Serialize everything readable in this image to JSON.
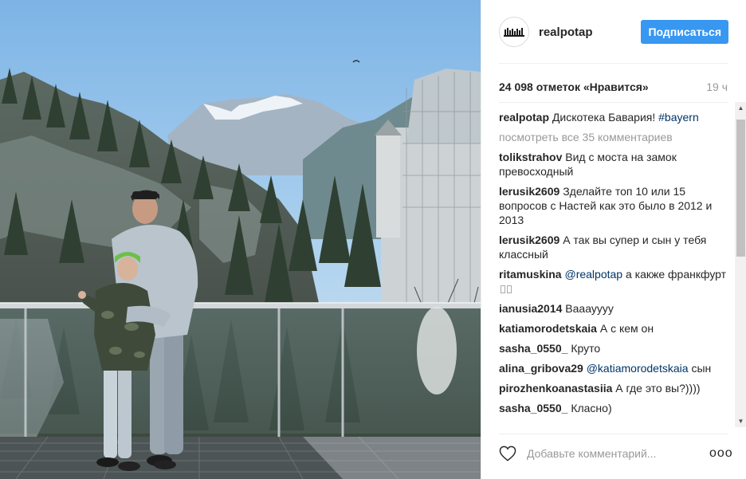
{
  "post": {
    "username": "realpotap",
    "follow_label": "Подписаться",
    "likes": "24 098 отметок «Нравится»",
    "time_ago": "19 ч",
    "view_all": "посмотреть все 35 комментариев",
    "comment_placeholder": "Добавьте комментарий...",
    "more_label": "ооо"
  },
  "caption": {
    "user": "realpotap",
    "text": "Дискотека Бавария!",
    "hashtag": "#bayern"
  },
  "comments": [
    {
      "user": "tolikstrahov",
      "text": "Вид с моста на замок превосходный"
    },
    {
      "user": "lerusik2609",
      "text": "Зделайте топ 10 или 15 вопросов с Настей как это было в 2012 и 2013"
    },
    {
      "user": "lerusik2609",
      "text": "А так вы супер и сын у тебя классный"
    },
    {
      "user": "ritamuskina",
      "mention": "@realpotap",
      "text": "а какже франкфурт"
    },
    {
      "user": "ianusia2014",
      "text": "Вааауууу"
    },
    {
      "user": "katiamorodetskaia",
      "text": "А с кем он"
    },
    {
      "user": "sasha_0550_",
      "text": "Круто"
    },
    {
      "user": "alina_gribova29",
      "mention": "@katiamorodetskaia",
      "text": "сын"
    },
    {
      "user": "pirozhenkoanastasiia",
      "text": "А где это вы?))))"
    },
    {
      "user": "sasha_0550_",
      "text": "Класно)"
    }
  ],
  "colors": {
    "accent": "#3897f0",
    "text": "#262626",
    "muted": "#999999",
    "link": "#003569"
  },
  "icons": [
    "heart-icon",
    "more-options-icon",
    "avatar-logo"
  ]
}
